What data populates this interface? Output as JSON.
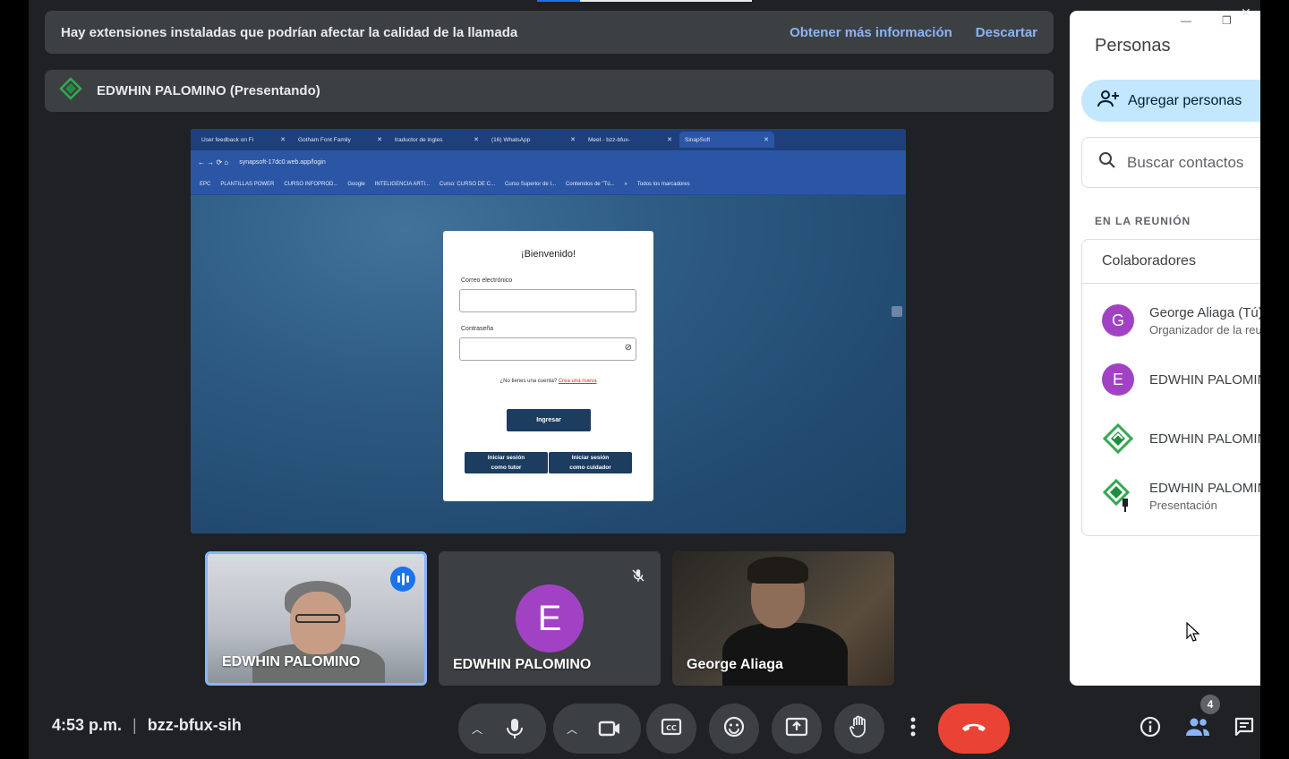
{
  "banner": {
    "text": "Hay extensiones instaladas que podrían afectar la calidad de la llamada",
    "more_info": "Obtener más información",
    "dismiss": "Descartar"
  },
  "presenter": {
    "label": "EDWHIN PALOMINO (Presentando)",
    "icon": "presentation-diamond-icon"
  },
  "shared_screen": {
    "tabs": [
      {
        "label": "User feedback on Fi",
        "active": false
      },
      {
        "label": "Gotham Font Family",
        "active": false
      },
      {
        "label": "traductor de ingles",
        "active": false
      },
      {
        "label": "(16) WhatsApp",
        "active": false
      },
      {
        "label": "Meet - bzz-bfux-",
        "active": false
      },
      {
        "label": "SinapSoft",
        "active": true
      }
    ],
    "url": "synapsoft-17dc0.web.app/login",
    "bookmarks": [
      "EPC",
      "PLANTILLAS POWER",
      "CURSO INFOPROD...",
      "Google",
      "INTELIGENCIA ARTI...",
      "Curso: CURSO DE C...",
      "Curso Superior de I...",
      "Contenidos de \"Tú...",
      "»",
      "Todos los marcadores"
    ],
    "login": {
      "title": "¡Bienvenido!",
      "email_label": "Correo electrónico",
      "password_label": "Contraseña",
      "no_account": "¿No tienes una cuenta?",
      "create_link": "Crea una nueva",
      "submit": "Ingresar",
      "tutor_btn_line1": "Iniciar sesión",
      "tutor_btn_line2": "como tutor",
      "caregiver_btn_line1": "Iniciar sesión",
      "caregiver_btn_line2": "como cuidador"
    }
  },
  "tiles": [
    {
      "name": "EDWHIN PALOMINO",
      "speaking": true
    },
    {
      "name": "EDWHIN PALOMINO",
      "avatar_letter": "E",
      "muted": true
    },
    {
      "name": "George Aliaga"
    }
  ],
  "panel": {
    "title": "Personas",
    "add_people": "Agregar personas",
    "search_placeholder": "Buscar contactos",
    "section": "EN LA REUNIÓN",
    "group": "Colaboradores",
    "participants": [
      {
        "avatar": "G",
        "name": "George Aliaga (Tú)",
        "sub": "Organizador de la reu"
      },
      {
        "avatar": "E",
        "name": "EDWHIN PALOMIN",
        "sub": ""
      },
      {
        "icon": "presentation-diamond-icon",
        "name": "EDWHIN PALOMIN",
        "sub": ""
      },
      {
        "icon": "presentation-pin-icon",
        "name": "EDWHIN PALOMIN",
        "sub": "Presentación"
      }
    ]
  },
  "bottom": {
    "time": "4:53 p.m.",
    "separator": "|",
    "meeting_code": "bzz-bfux-sih",
    "people_count": "4"
  },
  "colors": {
    "bg": "#202124",
    "surface": "#3c4043",
    "accent": "#8ab4f8",
    "end_call": "#ea4335",
    "avatar": "#a142c4"
  }
}
